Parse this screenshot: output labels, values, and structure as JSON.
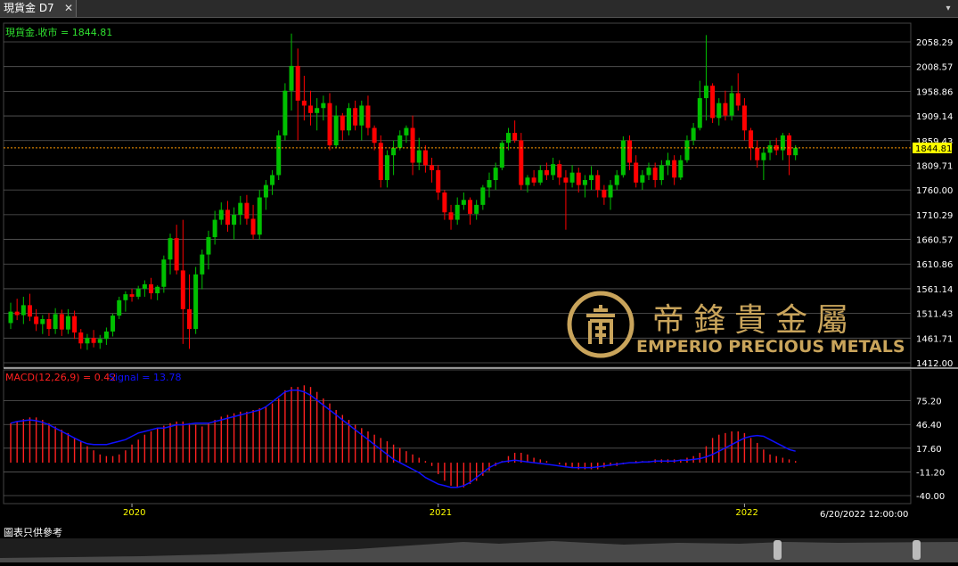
{
  "tab": {
    "title": "現貨金 D7",
    "close": "✕",
    "menu": "▾"
  },
  "footer_note": "圖表只供參考",
  "logo": {
    "cn": "帝鋒貴金屬",
    "en": "EMPERIO PRECIOUS METALS"
  },
  "colors": {
    "up": "#00c000",
    "down": "#ff0000",
    "macd": "#ff2020",
    "signal": "#1010ff",
    "axis_text": "#ffffff",
    "date_text": "#ffff00",
    "grid": "#5a5a5a",
    "last_price_line": "#ff9900",
    "last_price_box": "#ffff00"
  },
  "chart_data": {
    "type": "candlestick",
    "price_panel": {
      "legend": "現貨金.收市 = 1844.81",
      "last_value": 1844.81,
      "last_label": "1844.81",
      "ylim": [
        1412.0,
        2058.29
      ],
      "y_ticks": [
        "2058.29",
        "2008.57",
        "1958.86",
        "1909.14",
        "1859.43",
        "1809.71",
        "1760.00",
        "1710.29",
        "1660.57",
        "1610.86",
        "1561.14",
        "1511.43",
        "1461.71",
        "1412.00"
      ],
      "ohlc": [
        [
          1492,
          1533,
          1480,
          1515
        ],
        [
          1515,
          1541,
          1498,
          1508
        ],
        [
          1508,
          1545,
          1490,
          1528
        ],
        [
          1528,
          1551,
          1496,
          1505
        ],
        [
          1505,
          1520,
          1476,
          1490
        ],
        [
          1490,
          1508,
          1470,
          1500
        ],
        [
          1500,
          1512,
          1466,
          1480
        ],
        [
          1480,
          1522,
          1470,
          1510
        ],
        [
          1510,
          1519,
          1466,
          1479
        ],
        [
          1479,
          1520,
          1470,
          1506
        ],
        [
          1506,
          1517,
          1460,
          1473
        ],
        [
          1473,
          1480,
          1440,
          1451
        ],
        [
          1451,
          1470,
          1438,
          1462
        ],
        [
          1462,
          1478,
          1443,
          1452
        ],
        [
          1452,
          1468,
          1440,
          1460
        ],
        [
          1460,
          1483,
          1448,
          1475
        ],
        [
          1475,
          1511,
          1465,
          1507
        ],
        [
          1507,
          1545,
          1500,
          1538
        ],
        [
          1538,
          1556,
          1515,
          1550
        ],
        [
          1550,
          1561,
          1535,
          1545
        ],
        [
          1545,
          1567,
          1540,
          1561
        ],
        [
          1561,
          1578,
          1545,
          1570
        ],
        [
          1570,
          1583,
          1540,
          1552
        ],
        [
          1552,
          1568,
          1538,
          1565
        ],
        [
          1565,
          1628,
          1553,
          1620
        ],
        [
          1620,
          1672,
          1590,
          1663
        ],
        [
          1663,
          1690,
          1590,
          1598
        ],
        [
          1598,
          1700,
          1450,
          1520
        ],
        [
          1520,
          1590,
          1440,
          1480
        ],
        [
          1480,
          1605,
          1470,
          1590
        ],
        [
          1590,
          1640,
          1560,
          1630
        ],
        [
          1630,
          1678,
          1600,
          1665
        ],
        [
          1665,
          1718,
          1650,
          1700
        ],
        [
          1700,
          1735,
          1690,
          1720
        ],
        [
          1720,
          1738,
          1676,
          1690
        ],
        [
          1690,
          1725,
          1660,
          1710
        ],
        [
          1710,
          1748,
          1690,
          1734
        ],
        [
          1734,
          1750,
          1690,
          1702
        ],
        [
          1702,
          1730,
          1660,
          1670
        ],
        [
          1670,
          1760,
          1660,
          1745
        ],
        [
          1745,
          1780,
          1720,
          1770
        ],
        [
          1770,
          1800,
          1750,
          1790
        ],
        [
          1790,
          1880,
          1780,
          1870
        ],
        [
          1870,
          1975,
          1860,
          1960
        ],
        [
          1960,
          2075,
          1920,
          2010
        ],
        [
          2010,
          2045,
          1860,
          1940
        ],
        [
          1940,
          1990,
          1900,
          1930
        ],
        [
          1930,
          1960,
          1890,
          1915
        ],
        [
          1915,
          1945,
          1880,
          1925
        ],
        [
          1925,
          1950,
          1900,
          1935
        ],
        [
          1935,
          1955,
          1840,
          1850
        ],
        [
          1850,
          1930,
          1845,
          1910
        ],
        [
          1910,
          1915,
          1860,
          1880
        ],
        [
          1880,
          1935,
          1870,
          1925
        ],
        [
          1925,
          1940,
          1880,
          1890
        ],
        [
          1890,
          1940,
          1860,
          1930
        ],
        [
          1930,
          1950,
          1870,
          1885
        ],
        [
          1885,
          1890,
          1840,
          1855
        ],
        [
          1855,
          1870,
          1765,
          1780
        ],
        [
          1780,
          1840,
          1765,
          1830
        ],
        [
          1830,
          1860,
          1790,
          1845
        ],
        [
          1845,
          1880,
          1840,
          1870
        ],
        [
          1870,
          1890,
          1855,
          1885
        ],
        [
          1885,
          1910,
          1790,
          1815
        ],
        [
          1815,
          1865,
          1800,
          1840
        ],
        [
          1840,
          1850,
          1795,
          1810
        ],
        [
          1810,
          1825,
          1775,
          1800
        ],
        [
          1800,
          1810,
          1740,
          1755
        ],
        [
          1755,
          1760,
          1700,
          1715
        ],
        [
          1715,
          1730,
          1680,
          1700
        ],
        [
          1700,
          1745,
          1690,
          1730
        ],
        [
          1730,
          1755,
          1720,
          1740
        ],
        [
          1740,
          1745,
          1690,
          1712
        ],
        [
          1712,
          1740,
          1700,
          1730
        ],
        [
          1730,
          1770,
          1720,
          1765
        ],
        [
          1765,
          1795,
          1745,
          1780
        ],
        [
          1780,
          1815,
          1760,
          1805
        ],
        [
          1805,
          1860,
          1800,
          1855
        ],
        [
          1855,
          1885,
          1840,
          1875
        ],
        [
          1875,
          1900,
          1855,
          1860
        ],
        [
          1860,
          1875,
          1760,
          1770
        ],
        [
          1770,
          1790,
          1755,
          1785
        ],
        [
          1785,
          1800,
          1768,
          1775
        ],
        [
          1775,
          1810,
          1770,
          1800
        ],
        [
          1800,
          1815,
          1780,
          1790
        ],
        [
          1790,
          1825,
          1780,
          1812
        ],
        [
          1812,
          1820,
          1770,
          1785
        ],
        [
          1785,
          1800,
          1680,
          1775
        ],
        [
          1775,
          1810,
          1765,
          1795
        ],
        [
          1795,
          1805,
          1755,
          1770
        ],
        [
          1770,
          1790,
          1745,
          1780
        ],
        [
          1780,
          1808,
          1760,
          1790
        ],
        [
          1790,
          1800,
          1745,
          1760
        ],
        [
          1760,
          1770,
          1730,
          1745
        ],
        [
          1745,
          1780,
          1720,
          1770
        ],
        [
          1770,
          1800,
          1760,
          1790
        ],
        [
          1790,
          1868,
          1785,
          1860
        ],
        [
          1860,
          1870,
          1800,
          1815
        ],
        [
          1815,
          1830,
          1765,
          1775
        ],
        [
          1775,
          1800,
          1760,
          1790
        ],
        [
          1790,
          1815,
          1780,
          1805
        ],
        [
          1805,
          1815,
          1765,
          1780
        ],
        [
          1780,
          1820,
          1770,
          1810
        ],
        [
          1810,
          1835,
          1790,
          1820
        ],
        [
          1820,
          1830,
          1770,
          1785
        ],
        [
          1785,
          1830,
          1780,
          1820
        ],
        [
          1820,
          1870,
          1815,
          1860
        ],
        [
          1860,
          1895,
          1850,
          1885
        ],
        [
          1885,
          1980,
          1880,
          1945
        ],
        [
          1945,
          2072,
          1900,
          1970
        ],
        [
          1970,
          1975,
          1895,
          1905
        ],
        [
          1905,
          1945,
          1890,
          1935
        ],
        [
          1935,
          1960,
          1900,
          1910
        ],
        [
          1910,
          1970,
          1900,
          1955
        ],
        [
          1955,
          1995,
          1920,
          1930
        ],
        [
          1930,
          1945,
          1860,
          1880
        ],
        [
          1880,
          1885,
          1820,
          1845
        ],
        [
          1845,
          1860,
          1805,
          1820
        ],
        [
          1820,
          1845,
          1780,
          1835
        ],
        [
          1835,
          1860,
          1820,
          1850
        ],
        [
          1850,
          1865,
          1830,
          1840
        ],
        [
          1840,
          1875,
          1820,
          1870
        ],
        [
          1870,
          1875,
          1790,
          1830
        ],
        [
          1830,
          1850,
          1820,
          1845
        ]
      ]
    },
    "macd_panel": {
      "legend_macd": "MACD(12,26,9) = 0.42",
      "legend_signal": "Signal = 13.78",
      "ylim": [
        -40.0,
        90.0
      ],
      "y_ticks": [
        "75.20",
        "46.40",
        "17.60",
        "-11.20",
        "-40.00"
      ],
      "tick_values": [
        75.2,
        46.4,
        17.6,
        -11.2,
        -40.0
      ],
      "zero": 0,
      "macd": [
        48,
        50,
        53,
        55,
        55,
        52,
        48,
        44,
        40,
        36,
        30,
        26,
        20,
        15,
        10,
        8,
        8,
        10,
        15,
        22,
        28,
        34,
        38,
        42,
        45,
        48,
        50,
        50,
        48,
        46,
        44,
        48,
        52,
        56,
        58,
        60,
        62,
        62,
        64,
        66,
        68,
        72,
        78,
        88,
        92,
        92,
        94,
        92,
        86,
        78,
        72,
        64,
        58,
        52,
        46,
        42,
        38,
        34,
        30,
        26,
        22,
        18,
        14,
        10,
        6,
        2,
        -4,
        -14,
        -22,
        -28,
        -30,
        -30,
        -26,
        -22,
        -16,
        -10,
        -4,
        2,
        8,
        12,
        12,
        10,
        6,
        4,
        2,
        0,
        -2,
        -4,
        -6,
        -8,
        -8,
        -8,
        -8,
        -6,
        -4,
        -4,
        -2,
        0,
        2,
        2,
        2,
        4,
        4,
        4,
        4,
        4,
        6,
        8,
        12,
        20,
        30,
        34,
        36,
        38,
        38,
        36,
        30,
        24,
        16,
        10,
        8,
        6,
        4,
        2
      ],
      "signal": [
        48,
        50,
        51,
        52,
        51,
        49,
        46,
        42,
        38,
        34,
        30,
        26,
        23,
        22,
        22,
        22,
        24,
        26,
        28,
        32,
        36,
        38,
        40,
        42,
        42,
        44,
        46,
        46,
        47,
        48,
        48,
        48,
        50,
        52,
        54,
        56,
        58,
        60,
        62,
        64,
        68,
        74,
        80,
        86,
        88,
        88,
        86,
        82,
        76,
        70,
        64,
        58,
        52,
        46,
        40,
        34,
        28,
        22,
        16,
        10,
        4,
        0,
        -4,
        -8,
        -12,
        -18,
        -22,
        -26,
        -28,
        -30,
        -30,
        -28,
        -24,
        -18,
        -12,
        -6,
        -2,
        1,
        2,
        3,
        2,
        1,
        0,
        -1,
        -2,
        -3,
        -4,
        -5,
        -6,
        -6,
        -6,
        -6,
        -5,
        -4,
        -3,
        -2,
        -1,
        0,
        0,
        1,
        1,
        2,
        2,
        2,
        2,
        3,
        3,
        4,
        5,
        7,
        10,
        14,
        18,
        22,
        26,
        30,
        32,
        33,
        32,
        28,
        24,
        20,
        16,
        14
      ]
    },
    "x_ticks": [
      {
        "label": "2020",
        "index": 19
      },
      {
        "label": "2021",
        "index": 67
      },
      {
        "label": "2022",
        "index": 115
      }
    ],
    "date_label": "6/20/2022 12:00:00"
  }
}
